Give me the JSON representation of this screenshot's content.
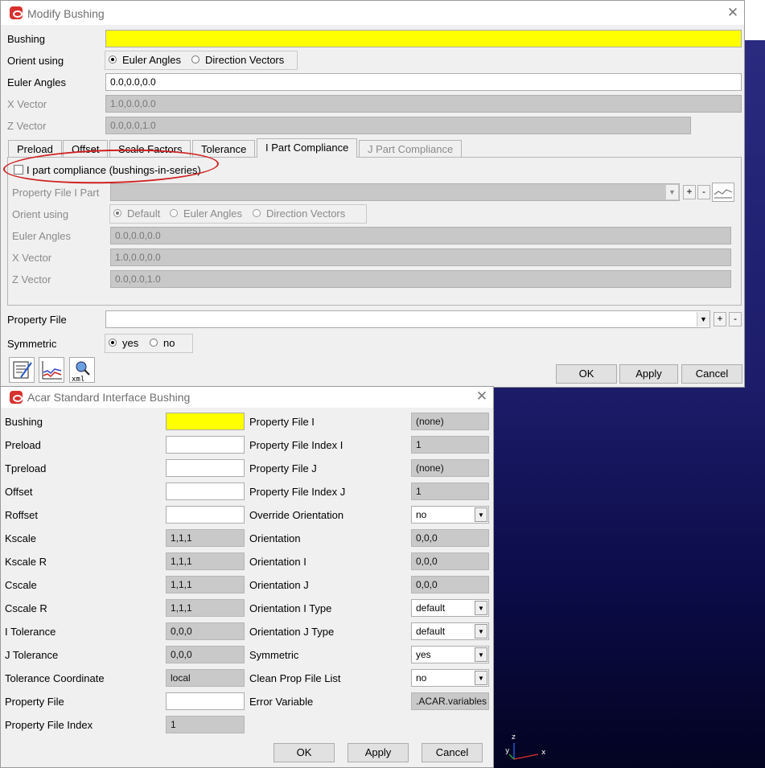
{
  "modify_bushing": {
    "title": "Modify Bushing",
    "bushing_label": "Bushing",
    "bushing_value": "",
    "orient_label": "Orient using",
    "orient_options": [
      "Euler Angles",
      "Direction Vectors"
    ],
    "euler_label": "Euler Angles",
    "euler_value": "0.0,0.0,0.0",
    "xvec_label": "X Vector",
    "xvec_value": "1.0,0.0,0.0",
    "zvec_label": "Z Vector",
    "zvec_value": "0.0,0.0,1.0",
    "tabs": [
      "Preload",
      "Offset",
      "Scale Factors",
      "Tolerance",
      "I Part Compliance",
      "J Part Compliance"
    ],
    "ipart": {
      "checkbox_label": "I part compliance (bushings-in-series)",
      "propfile_label": "Property File I Part",
      "orient_label": "Orient using",
      "orient_options": [
        "Default",
        "Euler Angles",
        "Direction Vectors"
      ],
      "euler_label": "Euler Angles",
      "euler_value": "0.0,0.0,0.0",
      "xvec_label": "X Vector",
      "xvec_value": "1.0,0.0,0.0",
      "zvec_label": "Z Vector",
      "zvec_value": "0.0,0.0,1.0"
    },
    "propfile_label": "Property File",
    "symmetric_label": "Symmetric",
    "symmetric_options": [
      "yes",
      "no"
    ],
    "plus": "+",
    "minus": "-",
    "ok": "OK",
    "apply": "Apply",
    "cancel": "Cancel"
  },
  "acar": {
    "title": "Acar Standard Interface Bushing",
    "left_rows": [
      {
        "label": "Bushing",
        "value": ""
      },
      {
        "label": "Preload",
        "value": ""
      },
      {
        "label": "Tpreload",
        "value": ""
      },
      {
        "label": "Offset",
        "value": ""
      },
      {
        "label": "Roffset",
        "value": ""
      },
      {
        "label": "Kscale",
        "value": "1,1,1"
      },
      {
        "label": "Kscale R",
        "value": "1,1,1"
      },
      {
        "label": "Cscale",
        "value": "1,1,1"
      },
      {
        "label": "Cscale R",
        "value": "1,1,1"
      },
      {
        "label": "I Tolerance",
        "value": "0,0,0"
      },
      {
        "label": "J Tolerance",
        "value": "0,0,0"
      },
      {
        "label": "Tolerance Coordinate",
        "value": "local"
      },
      {
        "label": "Property File",
        "value": ""
      },
      {
        "label": "Property File Index",
        "value": "1"
      }
    ],
    "right_rows": [
      {
        "label": "Property File I",
        "value": "(none)"
      },
      {
        "label": "Property File Index I",
        "value": "1"
      },
      {
        "label": "Property File J",
        "value": "(none)"
      },
      {
        "label": "Property File Index J",
        "value": "1"
      },
      {
        "label": "Override Orientation",
        "value": "no"
      },
      {
        "label": "Orientation",
        "value": "0,0,0"
      },
      {
        "label": "Orientation I",
        "value": "0,0,0"
      },
      {
        "label": "Orientation J",
        "value": "0,0,0"
      },
      {
        "label": "Orientation I Type",
        "value": "default"
      },
      {
        "label": "Orientation J Type",
        "value": "default"
      },
      {
        "label": "Symmetric",
        "value": "yes"
      },
      {
        "label": "Clean Prop File List",
        "value": "no"
      },
      {
        "label": "Error Variable",
        "value": ".ACAR.variables"
      }
    ],
    "ok": "OK",
    "apply": "Apply",
    "cancel": "Cancel"
  },
  "triad": {
    "z": "z",
    "y": "y",
    "x": "x"
  },
  "colors": {
    "highlight": "#ffff00",
    "annotation": "#d02020",
    "viewport": "#0c0c4a"
  }
}
